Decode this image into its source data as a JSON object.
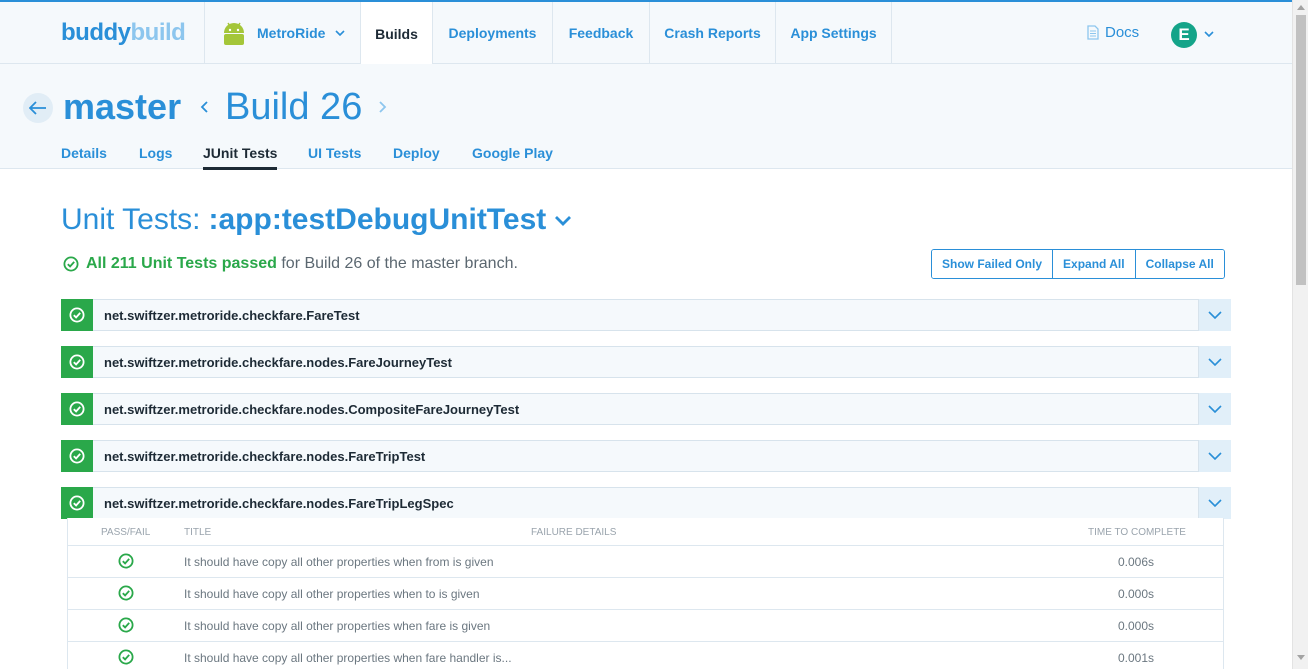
{
  "logo": {
    "part1": "buddy",
    "part2": "build"
  },
  "nav": {
    "app_name": "MetroRide",
    "items": [
      "Builds",
      "Deployments",
      "Feedback",
      "Crash Reports",
      "App Settings"
    ],
    "docs_label": "Docs",
    "avatar_initial": "E"
  },
  "header": {
    "branch": "master",
    "build_title": "Build 26",
    "tabs": [
      "Details",
      "Logs",
      "JUnit Tests",
      "UI Tests",
      "Deploy",
      "Google Play"
    ],
    "active_tab": "JUnit Tests"
  },
  "unit_tests": {
    "label": "Unit Tests:",
    "task": ":app:testDebugUnitTest",
    "summary_passed": "All 211 Unit Tests passed",
    "summary_rest": "for Build 26 of the master branch."
  },
  "buttons": {
    "show_failed": "Show Failed Only",
    "expand_all": "Expand All",
    "collapse_all": "Collapse All"
  },
  "suites": [
    "net.swiftzer.metroride.checkfare.FareTest",
    "net.swiftzer.metroride.checkfare.nodes.FareJourneyTest",
    "net.swiftzer.metroride.checkfare.nodes.CompositeFareJourneyTest",
    "net.swiftzer.metroride.checkfare.nodes.FareTripTest",
    "net.swiftzer.metroride.checkfare.nodes.FareTripLegSpec"
  ],
  "tests_table": {
    "headers": {
      "pass_fail": "PASS/FAIL",
      "title": "TITLE",
      "failure": "FAILURE DETAILS",
      "time": "TIME TO COMPLETE"
    },
    "rows": [
      {
        "title": "It should have copy all other properties when from is given",
        "time": "0.006s"
      },
      {
        "title": "It should have copy all other properties when to is given",
        "time": "0.000s"
      },
      {
        "title": "It should have copy all other properties when fare is given",
        "time": "0.000s"
      },
      {
        "title": "It should have copy all other properties when fare handler is...",
        "time": "0.001s"
      }
    ]
  },
  "colors": {
    "accent": "#2a8fd8",
    "pass": "#2aa84a",
    "avatar": "#14a489"
  }
}
